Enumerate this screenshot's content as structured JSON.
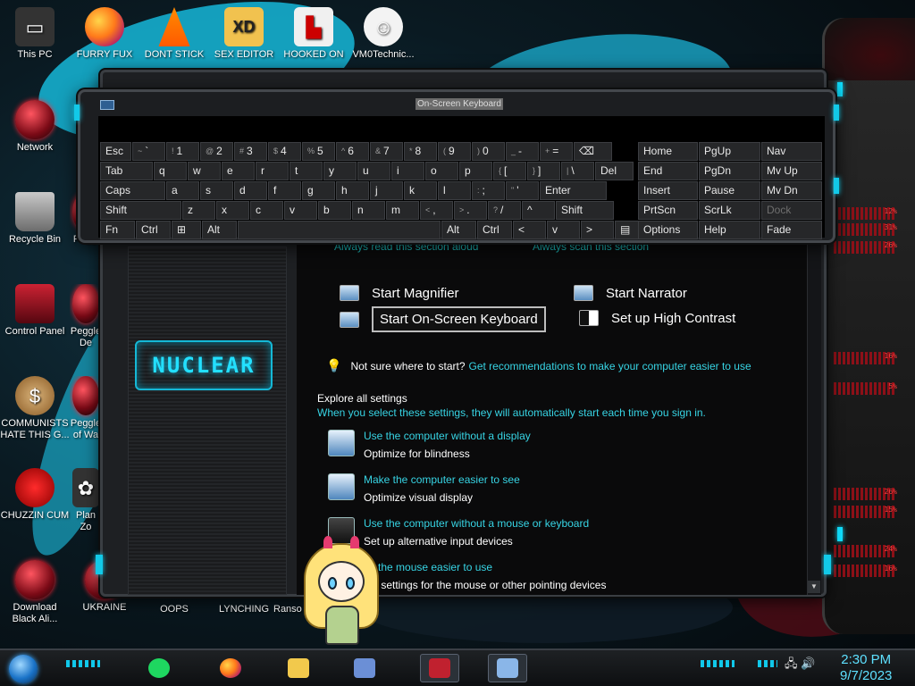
{
  "desktop": {
    "icons": [
      {
        "label": "This PC",
        "icon": "computer-icon"
      },
      {
        "label": "FURRY FUX",
        "icon": "firefox-icon"
      },
      {
        "label": "DONT STICK",
        "icon": "vlc-icon"
      },
      {
        "label": "SEX EDITOR",
        "icon": "xd-icon"
      },
      {
        "label": "HOOKED ON",
        "icon": "pixel-icon"
      },
      {
        "label": "VM0Technic...",
        "icon": "doctor-icon"
      },
      {
        "label": "Network",
        "icon": "network-orb-icon"
      },
      {
        "label": "Recycle Bin",
        "icon": "recycle-bin-icon"
      },
      {
        "label": "Control Panel",
        "icon": "control-panel-icon"
      },
      {
        "label": "COMMUNISTS HATE THIS G...",
        "icon": "money-bag-icon"
      },
      {
        "label": "CHUZZIN CUM",
        "icon": "chuzzle-icon"
      },
      {
        "label": "Download Black Ali...",
        "icon": "alienware-orb-icon"
      },
      {
        "label": "Peggl",
        "icon": "peggle-icon"
      },
      {
        "label": "Peggle De",
        "icon": "peggle-icon"
      },
      {
        "label": "Peggle of Wa",
        "icon": "peggle-icon"
      },
      {
        "label": "Plan Zo",
        "icon": "plants-icon"
      },
      {
        "label": "UKRAINE",
        "icon": "shortcut-icon"
      },
      {
        "label": "OOPS",
        "icon": "shortcut-icon"
      },
      {
        "label": "LYNCHING",
        "icon": "shortcut-icon"
      },
      {
        "label": "Ranso",
        "icon": "shortcut-icon"
      }
    ]
  },
  "gadget": {
    "readouts": [
      "12%",
      "31%",
      "26%",
      "16%",
      "5%",
      "26%",
      "15%",
      "24%",
      "16%"
    ]
  },
  "ease_window": {
    "top_checks": {
      "read": "Always read this section aloud",
      "scan": "Always scan this section"
    },
    "tools": {
      "magnifier": "Start Magnifier",
      "narrator": "Start Narrator",
      "osk": "Start On-Screen Keyboard",
      "contrast": "Set up High Contrast"
    },
    "hint": {
      "text": "Not sure where to start?",
      "link": "Get recommendations to make your computer easier to use"
    },
    "explore": {
      "title": "Explore all settings",
      "desc": "When you select these settings, they will automatically start each time you sign in."
    },
    "settings": [
      {
        "link": "Use the computer without a display",
        "sub": "Optimize for blindness"
      },
      {
        "link": "Make the computer easier to see",
        "sub": "Optimize visual display"
      },
      {
        "link": "Use the computer without a mouse or keyboard",
        "sub": "Set up alternative input devices"
      },
      {
        "link": "ke the mouse easier to use",
        "sub": "ust settings for the mouse or other pointing devices"
      }
    ],
    "logo": "NUCLEAR"
  },
  "osk": {
    "title": "On-Screen Keyboard",
    "rows": [
      [
        "Esc",
        "~ `",
        "! 1",
        "@ 2",
        "# 3",
        "$ 4",
        "% 5",
        "^ 6",
        "& 7",
        "* 8",
        "( 9",
        ") 0",
        "_ -",
        "+ =",
        "⌫"
      ],
      [
        "Tab",
        "q",
        "w",
        "e",
        "r",
        "t",
        "y",
        "u",
        "i",
        "o",
        "p",
        "{ [",
        "} ]",
        "| \\",
        "Del"
      ],
      [
        "Caps",
        "a",
        "s",
        "d",
        "f",
        "g",
        "h",
        "j",
        "k",
        "l",
        ": ;",
        "\" '",
        "Enter"
      ],
      [
        "Shift",
        "z",
        "x",
        "c",
        "v",
        "b",
        "n",
        "m",
        "< ,",
        "> .",
        "? /",
        "^",
        "Shift"
      ],
      [
        "Fn",
        "Ctrl",
        "⊞",
        "Alt",
        "",
        "Alt",
        "Ctrl",
        "<",
        "v",
        ">",
        "▤"
      ]
    ],
    "nav": [
      [
        "Home",
        "PgUp",
        "Nav"
      ],
      [
        "End",
        "PgDn",
        "Mv Up"
      ],
      [
        "Insert",
        "Pause",
        "Mv Dn"
      ],
      [
        "PrtScn",
        "ScrLk",
        "Dock"
      ],
      [
        "Options",
        "Help",
        "Fade"
      ]
    ]
  },
  "taskbar": {
    "apps": [
      {
        "name": "spotify",
        "icon": "spotify-icon",
        "color": "#1ed760"
      },
      {
        "name": "firefox",
        "icon": "firefox-icon",
        "color": "#ff7a1a"
      },
      {
        "name": "explorer",
        "icon": "folder-icon",
        "color": "#f2c94c"
      },
      {
        "name": "control-panel",
        "icon": "control-panel-icon",
        "color": "#6b8fd6"
      },
      {
        "name": "alienware",
        "icon": "alienware-icon",
        "color": "#c0212f"
      },
      {
        "name": "ease-of-access",
        "icon": "ease-of-access-icon",
        "color": "#8ab6e8"
      }
    ],
    "time": "2:30 PM",
    "date": "9/7/2023"
  }
}
